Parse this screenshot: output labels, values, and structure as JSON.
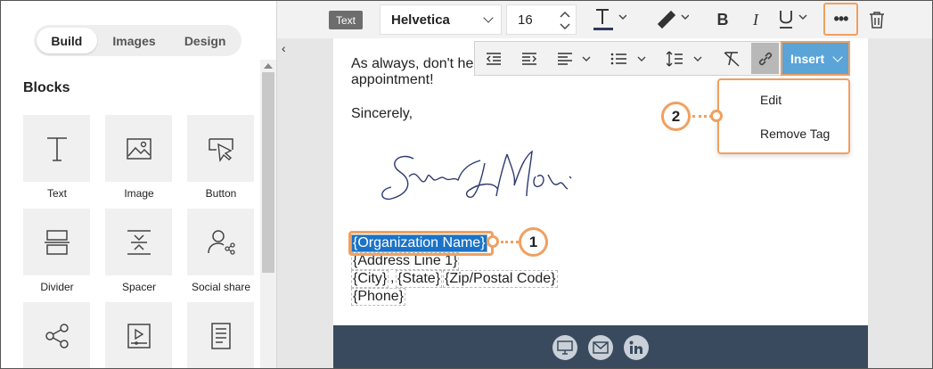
{
  "sidebar": {
    "tabs": [
      {
        "label": "Build",
        "active": true
      },
      {
        "label": "Images",
        "active": false
      },
      {
        "label": "Design",
        "active": false
      }
    ],
    "section_title": "Blocks",
    "blocks": [
      {
        "label": "Text",
        "icon": "text-icon"
      },
      {
        "label": "Image",
        "icon": "image-icon"
      },
      {
        "label": "Button",
        "icon": "button-icon"
      },
      {
        "label": "Divider",
        "icon": "divider-icon"
      },
      {
        "label": "Spacer",
        "icon": "spacer-icon"
      },
      {
        "label": "Social share",
        "icon": "social-share-icon"
      },
      {
        "label": "",
        "icon": "share-icon"
      },
      {
        "label": "",
        "icon": "video-icon"
      },
      {
        "label": "",
        "icon": "document-icon"
      }
    ]
  },
  "toolbar": {
    "element_type": "Text",
    "font": "Helvetica",
    "font_size": "16"
  },
  "toolbar2": {
    "insert_label": "Insert"
  },
  "dropdown": {
    "items": [
      "Edit",
      "Remove Tag"
    ]
  },
  "email": {
    "line1": "As always, don't he",
    "line2": "appointment!",
    "closing": "Sincerely,",
    "tags": {
      "org": "{Organization Name}",
      "address": "{Address Line 1}",
      "city": "{City}",
      "state": "{State}",
      "zip": "{Zip/Postal Code}",
      "phone": "{Phone}"
    }
  },
  "callouts": [
    "1",
    "2"
  ],
  "colors": {
    "accent": "#f0a060",
    "insert": "#5aa4d8",
    "footer": "#3a4a5e",
    "selection": "#1a73c8"
  }
}
